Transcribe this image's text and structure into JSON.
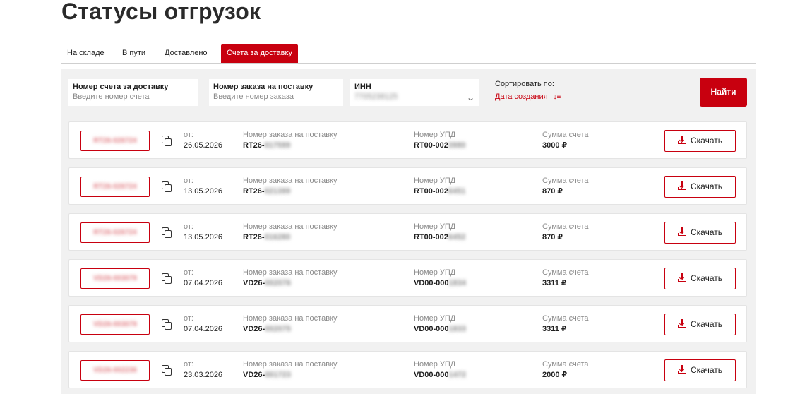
{
  "page": {
    "title": "Статусы отгрузок"
  },
  "tabs": [
    {
      "label": "На складе",
      "active": false
    },
    {
      "label": "В пути",
      "active": false
    },
    {
      "label": "Доставлено",
      "active": false
    },
    {
      "label": "Счета за доставку",
      "active": true
    }
  ],
  "filters": {
    "invoice": {
      "label": "Номер счета за доставку",
      "placeholder": "Введите номер счета"
    },
    "order": {
      "label": "Номер заказа на поставку",
      "placeholder": "Введите номер заказа"
    },
    "inn": {
      "label": "ИНН",
      "value": "7705238125"
    },
    "sort": {
      "label": "Сортировать по:",
      "value": "Дата создания"
    },
    "search_button": "Найти"
  },
  "labels": {
    "date_prefix": "от:",
    "order": "Номер заказа на поставку",
    "upd": "Номер УПД",
    "sum": "Сумма счета",
    "download": "Скачать"
  },
  "rows": [
    {
      "invoice": "RT26-026724",
      "date": "26.05.2026",
      "order_prefix": "RT26-",
      "order_hidden": "017599",
      "upd_prefix": "RT00-002",
      "upd_hidden": "3980",
      "sum": "3000 ₽"
    },
    {
      "invoice": "RT26-026724",
      "date": "13.05.2026",
      "order_prefix": "RT26-",
      "order_hidden": "021399",
      "upd_prefix": "RT00-002",
      "upd_hidden": "6451",
      "sum": "870 ₽"
    },
    {
      "invoice": "RT26-026724",
      "date": "13.05.2026",
      "order_prefix": "RT26-",
      "order_hidden": "016280",
      "upd_prefix": "RT00-002",
      "upd_hidden": "6452",
      "sum": "870 ₽"
    },
    {
      "invoice": "VD26-003079",
      "date": "07.04.2026",
      "order_prefix": "VD26-",
      "order_hidden": "002076",
      "upd_prefix": "VD00-000",
      "upd_hidden": "1834",
      "sum": "3311 ₽"
    },
    {
      "invoice": "VD26-003079",
      "date": "07.04.2026",
      "order_prefix": "VD26-",
      "order_hidden": "002075",
      "upd_prefix": "VD00-000",
      "upd_hidden": "1833",
      "sum": "3311 ₽"
    },
    {
      "invoice": "VD26-002236",
      "date": "23.03.2026",
      "order_prefix": "VD26-",
      "order_hidden": "001723",
      "upd_prefix": "VD00-000",
      "upd_hidden": "1472",
      "sum": "2000 ₽"
    }
  ],
  "colors": {
    "accent": "#c8000f",
    "panel_bg": "#f1f1f1"
  },
  "icons": {
    "copy": "copy-icon",
    "download": "download-icon",
    "sort": "sort-desc-icon",
    "dropdown": "chevron-down-icon"
  }
}
